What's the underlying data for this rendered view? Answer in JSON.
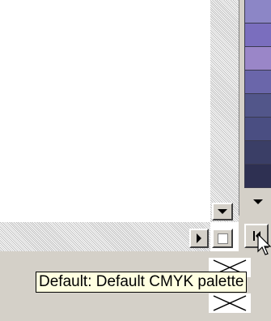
{
  "tooltip": {
    "text": "Default: Default CMYK palette"
  },
  "icons": {
    "scroll_down": "triangle-down",
    "scroll_right": "triangle-right",
    "palette_scroll_down": "triangle-down",
    "palette_first": "first-page",
    "no_color": "x-mark",
    "cursor": "arrow-pointer"
  },
  "palette": {
    "swatch_colors": [
      "#8c86c6",
      "#7a6ebe",
      "#9a86c8",
      "#6a66aa",
      "#52568a",
      "#4a4e82",
      "#3a3e66",
      "#2e3052"
    ]
  },
  "colors": {
    "window_face": "#d4d0c8",
    "canvas": "#ffffff",
    "tooltip_bg": "#ffffe1"
  }
}
